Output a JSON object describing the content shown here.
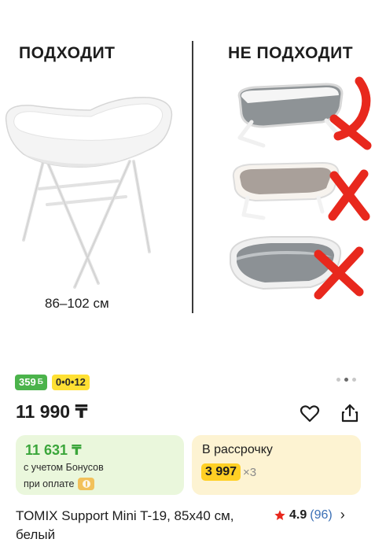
{
  "banner": {
    "fits_heading": "ПОДХОДИТ",
    "not_fits_heading": "НЕ ПОДХОДИТ",
    "size_caption": "86–102 см"
  },
  "badges": {
    "bonus_value": "359",
    "bonus_currency": "Б",
    "installment_code": "0•0•12"
  },
  "gallery": {
    "total": 3,
    "active_index": 1
  },
  "price": {
    "main": "11 990 ₸"
  },
  "bonus_card": {
    "price": "11 631 ₸",
    "line1": "с учетом Бонусов",
    "line2": "при оплате"
  },
  "installment_card": {
    "title": "В рассрочку",
    "amount": "3 997",
    "multiplier": "×3"
  },
  "product": {
    "title": "TOMIX Support Mini T-19, 85x40 см, белый",
    "rating": "4.9",
    "reviews": "(96)"
  },
  "colors": {
    "accent_green": "#4bb34b",
    "accent_yellow": "#ffe033",
    "cross_red": "#e8281d",
    "bonus_bg": "#eaf7dc",
    "install_bg": "#fdf3d2"
  },
  "icons": {
    "favorite": "heart-icon",
    "share": "share-icon",
    "rating": "star-icon",
    "more": "chevron-right-icon"
  }
}
